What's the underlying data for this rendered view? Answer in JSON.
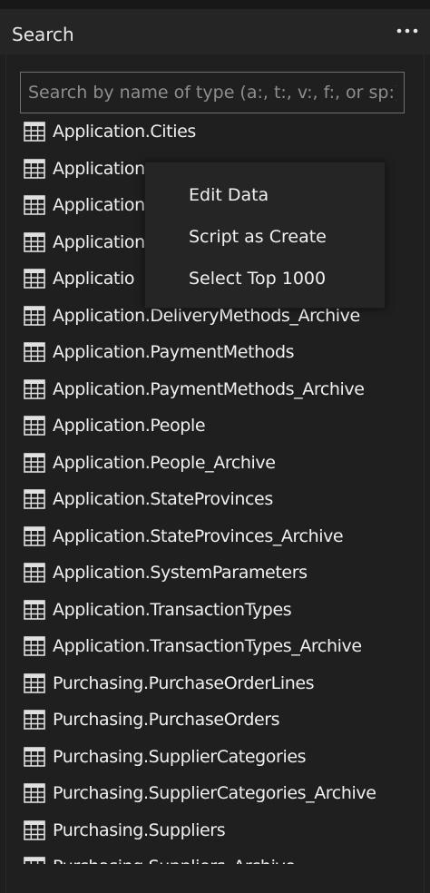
{
  "header": {
    "title": "Search",
    "more_icon": "more-horizontal-icon"
  },
  "search": {
    "value": "",
    "placeholder": "Search by name of type (a:, t:, v:, f:, or sp:)"
  },
  "results": [
    {
      "label": "Application.Cities",
      "icon": "table-icon"
    },
    {
      "label": "Application",
      "icon": "table-icon"
    },
    {
      "label": "Application",
      "icon": "table-icon"
    },
    {
      "label": "Application",
      "icon": "table-icon"
    },
    {
      "label": "Applicatio",
      "icon": "table-icon"
    },
    {
      "label": "Application.DeliveryMethods_Archive",
      "icon": "table-icon"
    },
    {
      "label": "Application.PaymentMethods",
      "icon": "table-icon"
    },
    {
      "label": "Application.PaymentMethods_Archive",
      "icon": "table-icon"
    },
    {
      "label": "Application.People",
      "icon": "table-icon"
    },
    {
      "label": "Application.People_Archive",
      "icon": "table-icon"
    },
    {
      "label": "Application.StateProvinces",
      "icon": "table-icon"
    },
    {
      "label": "Application.StateProvinces_Archive",
      "icon": "table-icon"
    },
    {
      "label": "Application.SystemParameters",
      "icon": "table-icon"
    },
    {
      "label": "Application.TransactionTypes",
      "icon": "table-icon"
    },
    {
      "label": "Application.TransactionTypes_Archive",
      "icon": "table-icon"
    },
    {
      "label": "Purchasing.PurchaseOrderLines",
      "icon": "table-icon"
    },
    {
      "label": "Purchasing.PurchaseOrders",
      "icon": "table-icon"
    },
    {
      "label": "Purchasing.SupplierCategories",
      "icon": "table-icon"
    },
    {
      "label": "Purchasing.SupplierCategories_Archive",
      "icon": "table-icon"
    },
    {
      "label": "Purchasing.Suppliers",
      "icon": "table-icon"
    },
    {
      "label": "Purchasing.Suppliers_Archive",
      "icon": "table-icon"
    }
  ],
  "context_menu": {
    "items": [
      {
        "label": "Edit Data"
      },
      {
        "label": "Script as Create"
      },
      {
        "label": "Select Top 1000"
      }
    ]
  },
  "colors": {
    "background": "#1f1f1f",
    "header": "#252526",
    "text": "#f0f0f0",
    "placeholder": "#8e8e8e",
    "menu_background": "#252526"
  }
}
